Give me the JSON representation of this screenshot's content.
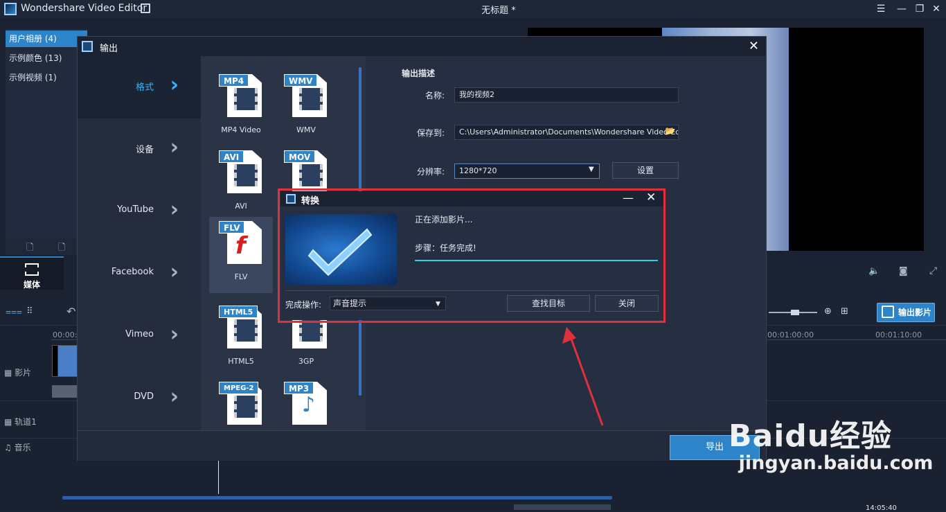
{
  "app": {
    "title": "Wondershare Video Editor",
    "document_title": "无标题 *"
  },
  "sidebar": {
    "items": [
      {
        "label": "用户相册 (4)"
      },
      {
        "label": "示例颜色 (13)"
      },
      {
        "label": "示例视频 (1)"
      }
    ]
  },
  "media_tab": {
    "label": "媒体"
  },
  "main_export_button": {
    "label": "输出影片"
  },
  "timeline": {
    "ruler": [
      "00:00:0",
      "00:01:00:00",
      "00:01:10:00"
    ],
    "tracks": [
      {
        "label": "影片"
      },
      {
        "label": "轨道1"
      },
      {
        "label": "音乐"
      }
    ],
    "time_readout": "14:05:40"
  },
  "output_dialog": {
    "title": "输出",
    "nav": [
      {
        "label": "格式"
      },
      {
        "label": "设备"
      },
      {
        "label": "YouTube"
      },
      {
        "label": "Facebook"
      },
      {
        "label": "Vimeo"
      },
      {
        "label": "DVD"
      }
    ],
    "formats": [
      {
        "tag": "MP4",
        "name": "MP4 Video"
      },
      {
        "tag": "WMV",
        "name": "WMV"
      },
      {
        "tag": "AVI",
        "name": "AVI"
      },
      {
        "tag": "MOV",
        "name": ""
      },
      {
        "tag": "FLV",
        "name": "FLV"
      },
      {
        "tag": "HTML5",
        "name": "HTML5"
      },
      {
        "tag": "3GP",
        "name": "3GP"
      },
      {
        "tag": "MPEG-2",
        "name": ""
      },
      {
        "tag": "MP3",
        "name": ""
      }
    ],
    "desc_title": "输出描述",
    "name_label": "名称:",
    "name_value": "我的视频2",
    "save_label": "保存到:",
    "save_value": "C:\\Users\\Administrator\\Documents\\Wondershare Video Editor",
    "resolution_label": "分辨率:",
    "resolution_value": "1280*720",
    "settings_button": "设置",
    "export_button": "导出"
  },
  "convert_dialog": {
    "title": "转换",
    "status": "正在添加影片...",
    "step": "步骤：任务完成!",
    "progress": 1.0,
    "complete_label": "完成操作:",
    "complete_value": "声音提示",
    "find_target_button": "查找目标",
    "close_button": "关闭"
  },
  "watermark": {
    "brand": "Baidu经验",
    "url": "jingyan.baidu.com"
  },
  "colors": {
    "accent": "#2d84c8",
    "highlight_frame": "#e0303a",
    "progress": "#2bd6e6"
  }
}
